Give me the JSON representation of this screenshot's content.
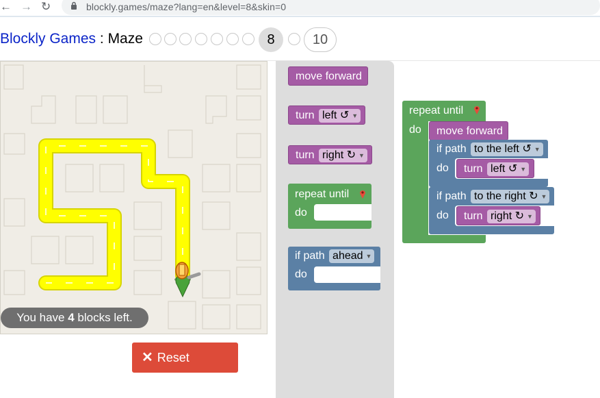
{
  "browser": {
    "url": "blockly.games/maze?lang=en&level=8&skin=0",
    "back_icon": "arrow-left-icon",
    "forward_icon": "arrow-right-icon",
    "reload_icon": "reload-icon",
    "lock_icon": "lock-icon"
  },
  "header": {
    "app_name": "Blockly Games",
    "separator": " : ",
    "game_name": "Maze",
    "current_level": "8",
    "last_level": "10",
    "level_indicators": 9
  },
  "maze": {
    "status_prefix": "You have ",
    "blocks_left": "4",
    "status_suffix": " blocks left.",
    "reset_label": "Reset",
    "reset_icon": "close-icon",
    "path_color": "#ffff00",
    "background_color": "#f0ede6"
  },
  "toolbox": {
    "move_forward": "move forward",
    "turn_left_word": "turn",
    "turn_left_value": "left ↺",
    "turn_right_word": "turn",
    "turn_right_value": "right ↻",
    "repeat_until": "repeat until",
    "repeat_do": "do",
    "if_path": "if path",
    "if_value": "ahead",
    "if_do": "do"
  },
  "workspace": {
    "repeat_until": "repeat until",
    "repeat_do": "do",
    "move_forward": "move forward",
    "if1_label": "if path",
    "if1_value": "to the left ↺",
    "if1_do": "do",
    "if1_turn": "turn",
    "if1_turn_value": "left ↺",
    "if2_label": "if path",
    "if2_value": "to the right ↻",
    "if2_do": "do",
    "if2_turn": "turn",
    "if2_turn_value": "right ↻"
  },
  "colors": {
    "purple": "#a55ba5",
    "green": "#5ba55b",
    "blue": "#5b80a5",
    "reset": "#dd4b39"
  }
}
